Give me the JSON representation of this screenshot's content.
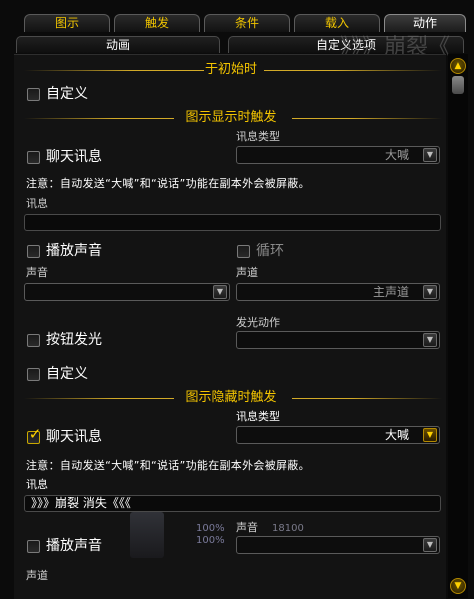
{
  "tabs": [
    "图示",
    "触发",
    "条件",
    "载入",
    "动作"
  ],
  "subtabs": [
    "动画",
    "自定义选项"
  ],
  "background_text": "》》》崩裂《",
  "sections": {
    "on_init": "于初始时",
    "on_show": "图示显示时触发",
    "on_hide": "图示隐藏时触发"
  },
  "on_init": {
    "custom_label": "自定义"
  },
  "on_show": {
    "chat_label": "聊天讯息",
    "message_type_label": "讯息类型",
    "message_type_value": "大喊",
    "note": "注意：自动发送“大喊”和“说话”功能在副本外会被屏蔽。",
    "message_label": "讯息",
    "message_value": "",
    "play_sound_label": "播放声音",
    "loop_label": "循环",
    "sound_label": "声音",
    "sound_value": "",
    "channel_label": "声道",
    "channel_value": "主声道",
    "glow_label": "按钮发光",
    "glow_action_label": "发光动作",
    "glow_action_value": "",
    "custom_label": "自定义"
  },
  "on_hide": {
    "chat_label": "聊天讯息",
    "chat_checked": true,
    "message_type_label": "讯息类型",
    "message_type_value": "大喊",
    "note": "注意：自动发送“大喊”和“说话”功能在副本外会被屏蔽。",
    "message_label": "讯息",
    "message_value": "》》》崩裂 消失《《《",
    "play_sound_label": "播放声音",
    "sound_label": "声音",
    "sound_value": "",
    "channel_label": "声道"
  },
  "bg_numbers": [
    "100%",
    "100%",
    "18100"
  ],
  "colors": {
    "accent_gold": "#f3c400",
    "background": "#131313"
  }
}
